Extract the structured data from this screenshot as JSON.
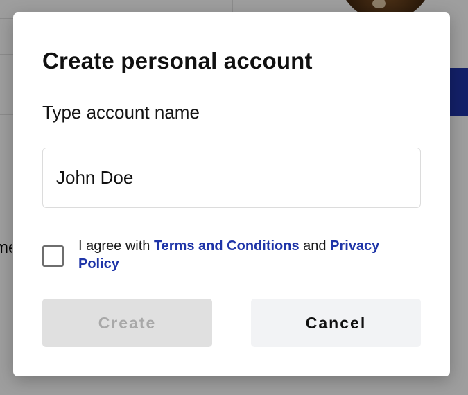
{
  "background": {
    "partial_text": "me"
  },
  "modal": {
    "title": "Create personal account",
    "field_label": "Type account name",
    "account_name_value": "John Doe",
    "agree": {
      "prefix": "I agree with ",
      "terms_link": "Terms and Conditions",
      "middle": " and ",
      "privacy_link": "Privacy Policy",
      "checked": false
    },
    "create_label": "Create",
    "cancel_label": "Cancel"
  },
  "colors": {
    "link": "#1f35a8",
    "disabled_button_bg": "#e0e0e0",
    "cancel_button_bg": "#f2f3f5"
  },
  "icons": {
    "checkbox": "checkbox-unchecked-icon"
  }
}
